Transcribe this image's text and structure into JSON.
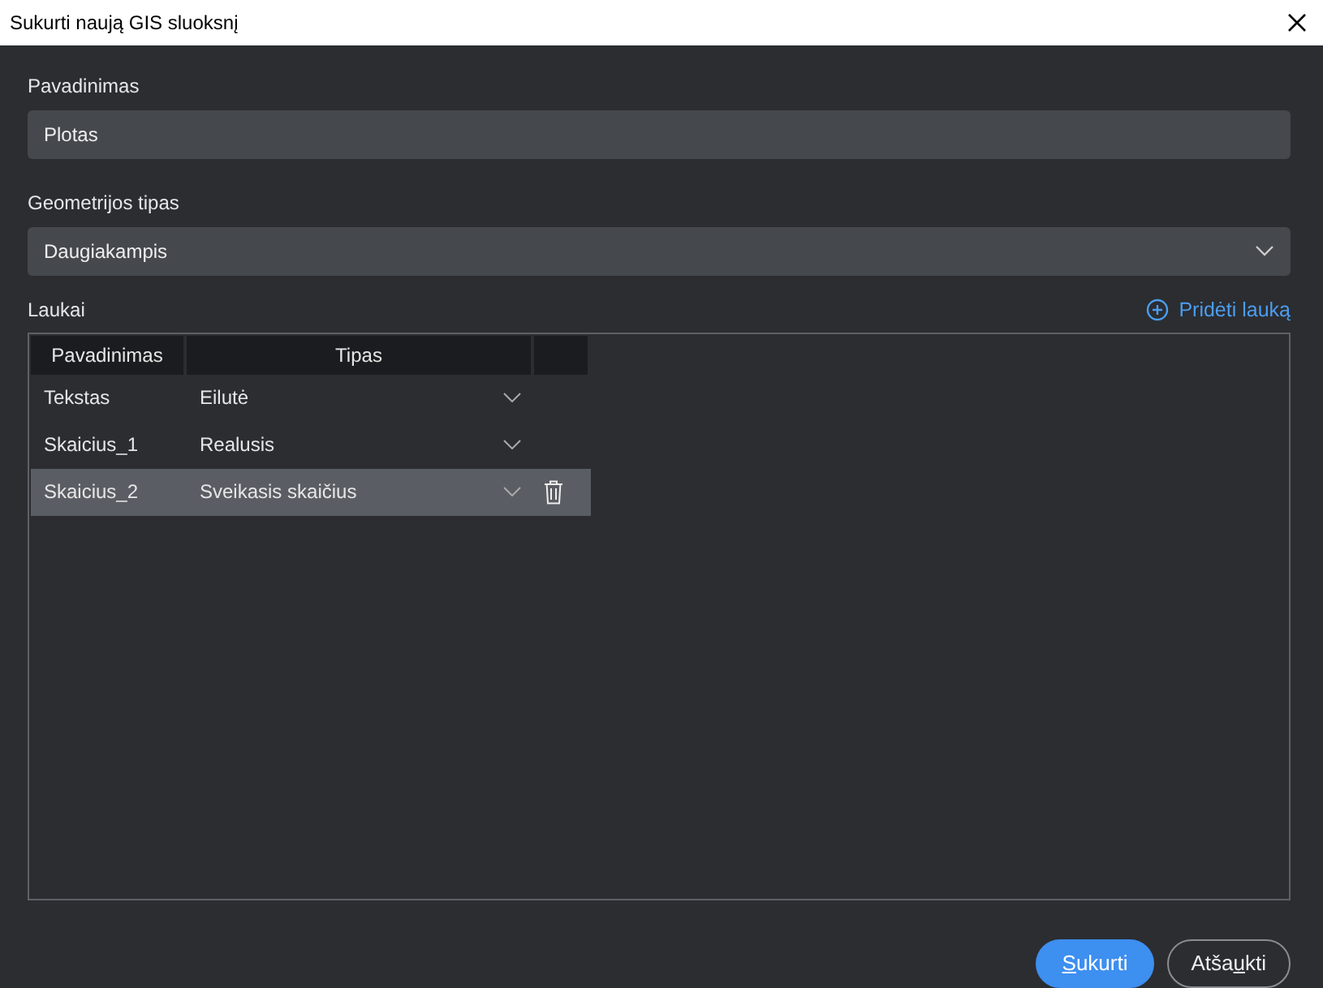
{
  "window": {
    "title": "Sukurti naują GIS sluoksnį"
  },
  "name_field": {
    "label": "Pavadinimas",
    "value": "Plotas"
  },
  "geometry_field": {
    "label": "Geometrijos tipas",
    "value": "Daugiakampis"
  },
  "fields_section": {
    "label": "Laukai",
    "add_link": "Pridėti lauką"
  },
  "table": {
    "columns": [
      "Pavadinimas",
      "Tipas"
    ],
    "rows": [
      {
        "name": "Tekstas",
        "type": "Eilutė",
        "selected": false
      },
      {
        "name": "Skaicius_1",
        "type": "Realusis",
        "selected": false
      },
      {
        "name": "Skaicius_2",
        "type": "Sveikasis skaičius",
        "selected": true
      }
    ]
  },
  "buttons": [
    {
      "kind": "primary",
      "access_key": "S",
      "label_rest": "ukurti"
    },
    {
      "kind": "outline",
      "label_start": "Atša",
      "access_key": "u",
      "label_rest": "kti"
    }
  ]
}
